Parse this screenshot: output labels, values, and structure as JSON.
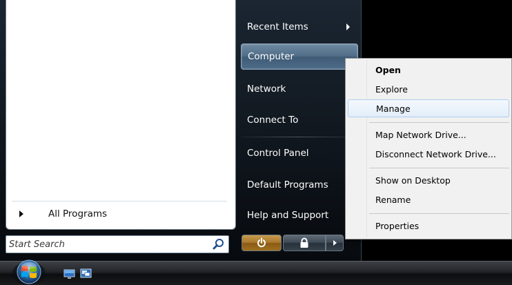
{
  "start_menu": {
    "all_programs_label": "All Programs",
    "search_placeholder": "Start Search",
    "right_items": [
      {
        "label": "Recent Items",
        "has_submenu": true
      },
      {
        "label": "Computer",
        "highlighted": true
      },
      {
        "label": "Network"
      },
      {
        "label": "Connect To"
      },
      {
        "label": "Control Panel"
      },
      {
        "label": "Default Programs"
      },
      {
        "label": "Help and Support"
      }
    ],
    "power_buttons": [
      "power-icon",
      "lock-icon",
      "more-options-arrow"
    ]
  },
  "context_menu": {
    "items": [
      {
        "label": "Open",
        "bold": true
      },
      {
        "label": "Explore"
      },
      {
        "label": "Manage",
        "highlighted": true
      },
      {
        "label": "Map Network Drive..."
      },
      {
        "label": "Disconnect Network Drive..."
      },
      {
        "label": "Show on Desktop"
      },
      {
        "label": "Rename"
      },
      {
        "label": "Properties"
      }
    ]
  },
  "taskbar": {
    "start_button_icon": "windows-orb-icon",
    "quick_launch_icons": [
      "show-desktop-icon",
      "switch-windows-icon"
    ]
  },
  "colors": {
    "highlight_blue": "#506d88",
    "power_amber": "#a9772b",
    "menu_hover": "#e3eef9"
  }
}
